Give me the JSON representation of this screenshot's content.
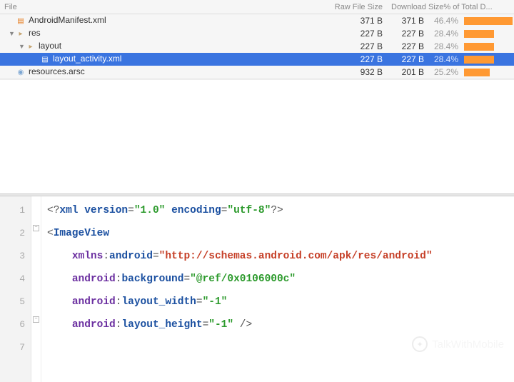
{
  "header": {
    "file": "File",
    "raw_size": "Raw File Size",
    "download_size": "Download Size% of Total D..."
  },
  "tree": [
    {
      "indent": 0,
      "chev": "",
      "icon": "xml",
      "name": "AndroidManifest.xml",
      "raw": "371 B",
      "dl": "371 B",
      "pct": "46.4%",
      "bar": 68,
      "sel": false
    },
    {
      "indent": 0,
      "chev": "▼",
      "icon": "folder",
      "name": "res",
      "raw": "227 B",
      "dl": "227 B",
      "pct": "28.4%",
      "bar": 42,
      "sel": false
    },
    {
      "indent": 1,
      "chev": "▼",
      "icon": "folder",
      "name": "layout",
      "raw": "227 B",
      "dl": "227 B",
      "pct": "28.4%",
      "bar": 42,
      "sel": false
    },
    {
      "indent": 2,
      "chev": "",
      "icon": "xml",
      "name": "layout_activity.xml",
      "raw": "227 B",
      "dl": "227 B",
      "pct": "28.4%",
      "bar": 42,
      "sel": true
    },
    {
      "indent": 0,
      "chev": "",
      "icon": "arsc",
      "name": "resources.arsc",
      "raw": "932 B",
      "dl": "201 B",
      "pct": "25.2%",
      "bar": 36,
      "sel": false
    }
  ],
  "code": {
    "lines": [
      "1",
      "2",
      "3",
      "4",
      "5",
      "6",
      "7"
    ],
    "xml_decl_version_key": "version",
    "xml_decl_version_val": "\"1.0\"",
    "xml_decl_encoding_key": "encoding",
    "xml_decl_encoding_val": "\"utf-8\"",
    "tag": "ImageView",
    "ns_prefix": "xmlns",
    "ns_local": "android",
    "ns_val": "\"http://schemas.android.com/apk/res/android\"",
    "attr_prefix": "android",
    "bg_key": "background",
    "bg_val": "\"@ref/0x0106000c\"",
    "w_key": "layout_width",
    "w_val": "\"-1\"",
    "h_key": "layout_height",
    "h_val": "\"-1\""
  },
  "watermark": "TalkWithMobile"
}
